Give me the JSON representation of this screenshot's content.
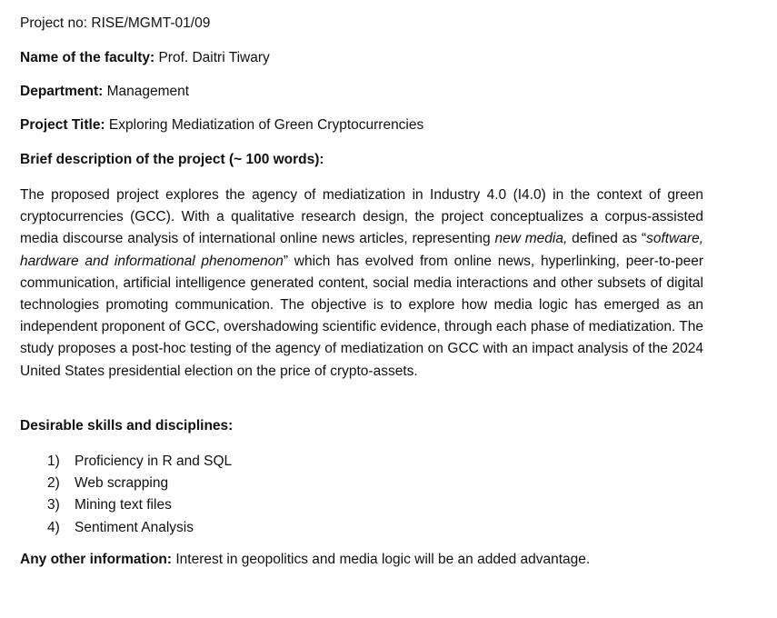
{
  "project_no": "Project no: RISE/MGMT-01/09",
  "faculty": {
    "label": "Name of the faculty:",
    "value": "Prof. Daitri Tiwary"
  },
  "department": {
    "label": "Department:",
    "value": "Management"
  },
  "project_title": {
    "label": "Project Title:",
    "value": "Exploring Mediatization of Green Cryptocurrencies"
  },
  "description_heading": "Brief description of the project (~ 100 words):",
  "description": {
    "part1": "The proposed project explores the agency of mediatization in Industry 4.0 (I4.0) in the context of green cryptocurrencies (GCC). With a qualitative research design, the project conceptualizes a corpus-assisted media discourse analysis of international online news articles, representing ",
    "italic1": "new media,",
    "part2": " defined as “",
    "italic2": "software, hardware and informational phenomenon",
    "part3": "” which has evolved from online news, hyperlinking, peer-to-peer communication, artificial intelligence generated content, social media interactions and other subsets of digital technologies promoting communication.  The objective is to explore how media logic has emerged as an independent proponent of GCC, overshadowing scientific evidence, through each phase of mediatization. The study proposes a post-hoc testing of the agency of mediatization on GCC with an impact analysis of the 2024 United States presidential election on the price of crypto-assets."
  },
  "skills_heading": "Desirable skills and disciplines:",
  "skills": [
    {
      "num": "1)",
      "text": "Proficiency in R and SQL"
    },
    {
      "num": "2)",
      "text": "Web scrapping"
    },
    {
      "num": "3)",
      "text": "Mining text files"
    },
    {
      "num": "4)",
      "text": "Sentiment Analysis"
    }
  ],
  "other_info": {
    "label": "Any other information:",
    "value": "Interest in geopolitics and media logic will be an added advantage."
  }
}
